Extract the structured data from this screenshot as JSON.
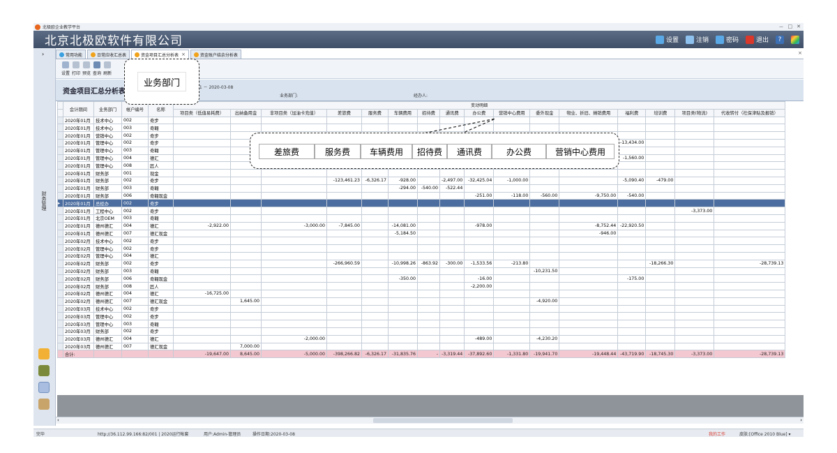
{
  "window": {
    "title": "北极欧企业教学平台",
    "controls": [
      "－",
      "□",
      "✕"
    ]
  },
  "header": {
    "company": "北京北极欧软件有限公司",
    "buttons": [
      {
        "label": "设置",
        "icon": "settings-icon",
        "color": "#5aa9e6"
      },
      {
        "label": "注销",
        "icon": "logout-icon",
        "color": "#8fc1ef"
      },
      {
        "label": "密码",
        "icon": "password-icon",
        "color": "#5aa9e6"
      },
      {
        "label": "退出",
        "icon": "power-icon",
        "color": "#d9382b"
      },
      {
        "label": "?",
        "icon": "help-icon",
        "color": "#3c6fb4"
      }
    ]
  },
  "sidebar": {
    "label": "财务管理",
    "collapse": "›"
  },
  "tabs": [
    {
      "label": "常用功能",
      "active": false
    },
    {
      "label": "日常应收汇总表",
      "active": false
    },
    {
      "label": "资金项目汇总分析表",
      "active": true
    },
    {
      "label": "资金账户结余分析表",
      "active": false
    }
  ],
  "toolbar": [
    "设置",
    "打印",
    "预览",
    "查询",
    "刷新"
  ],
  "report": {
    "title": "资金项目汇总分析表",
    "period": "01 － 2020-03-08",
    "dept_label": "业务部门:",
    "agent_label": "经办人:"
  },
  "grid": {
    "group_header": "变动明细",
    "columns": [
      "会计期间",
      "业务部门",
      "帐户编号",
      "名称",
      "项目类（低值易耗费）",
      "出纳备用金",
      "非项目类（加油卡充值）",
      "差旅费",
      "服务费",
      "车辆费用",
      "招待费",
      "通讯费",
      "办公费",
      "营销中心费用",
      "委外现金",
      "物业、折旧、摊销费用",
      "福利费",
      "培训费",
      "项目类(物流)",
      "代收转付（社保津贴及报销）"
    ],
    "rows": [
      {
        "c": [
          "2020年01月",
          "技术中心",
          "002",
          "奇步",
          "",
          "",
          "",
          "",
          "",
          "",
          "",
          "",
          "",
          "",
          "",
          "",
          "",
          "",
          "",
          ""
        ]
      },
      {
        "c": [
          "2020年01月",
          "技术中心",
          "003",
          "奇翱",
          "",
          "",
          "",
          "",
          "",
          "",
          "",
          "",
          "",
          "",
          "",
          "",
          "",
          "",
          "",
          ""
        ]
      },
      {
        "c": [
          "2020年01月",
          "营销中心",
          "002",
          "奇步",
          "",
          "",
          "",
          "",
          "",
          "",
          "",
          "",
          "",
          "",
          "",
          "",
          "",
          "",
          "",
          ""
        ]
      },
      {
        "c": [
          "2020年01月",
          "管理中心",
          "002",
          "奇步",
          "",
          "",
          "",
          "",
          "",
          "",
          "",
          "",
          "",
          "",
          "",
          "",
          "-13,434.00",
          "",
          "",
          ""
        ]
      },
      {
        "c": [
          "2020年01月",
          "管理中心",
          "003",
          "奇翱",
          "",
          "",
          "",
          "",
          "",
          "",
          "",
          "",
          "",
          "",
          "",
          "",
          "",
          "",
          "",
          ""
        ]
      },
      {
        "c": [
          "2020年01月",
          "管理中心",
          "004",
          "德汇",
          "",
          "",
          "",
          "",
          "",
          "",
          "",
          "",
          "",
          "",
          "",
          "",
          "-1,560.00",
          "",
          "",
          ""
        ]
      },
      {
        "c": [
          "2020年01月",
          "管理中心",
          "008",
          "匠人",
          "",
          "",
          "",
          "",
          "",
          "",
          "",
          "",
          "",
          "",
          "",
          "",
          "",
          "",
          "",
          ""
        ]
      },
      {
        "c": [
          "2020年01月",
          "财务部",
          "001",
          "现金",
          "",
          "",
          "",
          "",
          "",
          "",
          "",
          "",
          "",
          "",
          "",
          "",
          "",
          "",
          "",
          ""
        ]
      },
      {
        "c": [
          "2020年01月",
          "财务部",
          "002",
          "奇步",
          "",
          "",
          "",
          "-123,461.23",
          "-6,326.17",
          "-928.00",
          "",
          "-2,497.00",
          "-32,425.04",
          "-1,000.00",
          "",
          "",
          "-5,090.40",
          "-479.00",
          "",
          ""
        ]
      },
      {
        "c": [
          "2020年01月",
          "财务部",
          "003",
          "奇翱",
          "",
          "",
          "",
          "",
          "",
          "-294.00",
          "-540.00",
          "-522.44",
          "",
          "",
          "",
          "",
          "",
          "",
          "",
          ""
        ]
      },
      {
        "c": [
          "2020年01月",
          "财务部",
          "006",
          "奇翱现金",
          "",
          "",
          "",
          "",
          "",
          "",
          "",
          "",
          "-251.00",
          "-118.00",
          "-560.00",
          "-9,750.00",
          "-540.00",
          "",
          "",
          ""
        ]
      },
      {
        "c": [
          "2020年01月",
          "总经办",
          "002",
          "奇步",
          "",
          "",
          "",
          "",
          "",
          "",
          "",
          "",
          "",
          "",
          "",
          "",
          "",
          "",
          "",
          ""
        ],
        "selected": true
      },
      {
        "c": [
          "2020年01月",
          "工程中心",
          "002",
          "奇步",
          "",
          "",
          "",
          "",
          "",
          "",
          "",
          "",
          "",
          "",
          "",
          "",
          "",
          "",
          "-3,373.00",
          ""
        ]
      },
      {
        "c": [
          "2020年01月",
          "北京OEM",
          "003",
          "奇翱",
          "",
          "",
          "",
          "",
          "",
          "",
          "",
          "",
          "",
          "",
          "",
          "",
          "",
          "",
          "",
          ""
        ]
      },
      {
        "c": [
          "2020年01月",
          "德州德汇",
          "004",
          "德汇",
          "-2,922.00",
          "",
          "-3,000.00",
          "-7,845.00",
          "",
          "-14,081.00",
          "",
          "",
          "-978.00",
          "",
          "",
          "-8,752.44",
          "-22,920.50",
          "",
          "",
          ""
        ]
      },
      {
        "c": [
          "2020年01月",
          "德州德汇",
          "007",
          "德汇现金",
          "",
          "",
          "",
          "",
          "",
          "-5,184.50",
          "",
          "",
          "",
          "",
          "",
          "-946.00",
          "",
          "",
          "",
          ""
        ]
      },
      {
        "c": [
          "2020年02月",
          "技术中心",
          "002",
          "奇步",
          "",
          "",
          "",
          "",
          "",
          "",
          "",
          "",
          "",
          "",
          "",
          "",
          "",
          "",
          "",
          ""
        ]
      },
      {
        "c": [
          "2020年02月",
          "管理中心",
          "002",
          "奇步",
          "",
          "",
          "",
          "",
          "",
          "",
          "",
          "",
          "",
          "",
          "",
          "",
          "",
          "",
          "",
          ""
        ]
      },
      {
        "c": [
          "2020年02月",
          "管理中心",
          "004",
          "德汇",
          "",
          "",
          "",
          "",
          "",
          "",
          "",
          "",
          "",
          "",
          "",
          "",
          "",
          "",
          "",
          ""
        ]
      },
      {
        "c": [
          "2020年02月",
          "财务部",
          "002",
          "奇步",
          "",
          "",
          "",
          "-266,960.59",
          "",
          "-10,998.26",
          "-863.92",
          "-300.00",
          "-1,533.56",
          "-213.80",
          "",
          "",
          "",
          "-18,266.30",
          "",
          "-28,739.13"
        ]
      },
      {
        "c": [
          "2020年02月",
          "财务部",
          "003",
          "奇翱",
          "",
          "",
          "",
          "",
          "",
          "",
          "",
          "",
          "",
          "",
          "-10,231.50",
          "",
          "",
          "",
          "",
          ""
        ]
      },
      {
        "c": [
          "2020年02月",
          "财务部",
          "006",
          "奇翱现金",
          "",
          "",
          "",
          "",
          "",
          "-350.00",
          "",
          "",
          "-16.00",
          "",
          "",
          "",
          "-175.00",
          "",
          "",
          ""
        ]
      },
      {
        "c": [
          "2020年02月",
          "财务部",
          "008",
          "匠人",
          "",
          "",
          "",
          "",
          "",
          "",
          "",
          "",
          "-2,200.00",
          "",
          "",
          "",
          "",
          "",
          "",
          ""
        ]
      },
      {
        "c": [
          "2020年02月",
          "德州德汇",
          "004",
          "德汇",
          "-16,725.00",
          "",
          "",
          "",
          "",
          "",
          "",
          "",
          "",
          "",
          "",
          "",
          "",
          "",
          "",
          ""
        ]
      },
      {
        "c": [
          "2020年02月",
          "德州德汇",
          "007",
          "德汇现金",
          "",
          "1,645.00",
          "",
          "",
          "",
          "",
          "",
          "",
          "",
          "",
          "-4,920.00",
          "",
          "",
          "",
          "",
          ""
        ]
      },
      {
        "c": [
          "2020年03月",
          "技术中心",
          "002",
          "奇步",
          "",
          "",
          "",
          "",
          "",
          "",
          "",
          "",
          "",
          "",
          "",
          "",
          "",
          "",
          "",
          ""
        ]
      },
      {
        "c": [
          "2020年03月",
          "管理中心",
          "002",
          "奇步",
          "",
          "",
          "",
          "",
          "",
          "",
          "",
          "",
          "",
          "",
          "",
          "",
          "",
          "",
          "",
          ""
        ]
      },
      {
        "c": [
          "2020年03月",
          "管理中心",
          "003",
          "奇翱",
          "",
          "",
          "",
          "",
          "",
          "",
          "",
          "",
          "",
          "",
          "",
          "",
          "",
          "",
          "",
          ""
        ]
      },
      {
        "c": [
          "2020年03月",
          "财务部",
          "002",
          "奇步",
          "",
          "",
          "",
          "",
          "",
          "",
          "",
          "",
          "",
          "",
          "",
          "",
          "",
          "",
          "",
          ""
        ]
      },
      {
        "c": [
          "2020年03月",
          "德州德汇",
          "004",
          "德汇",
          "",
          "",
          "-2,000.00",
          "",
          "",
          "",
          "",
          "",
          "-489.00",
          "",
          "-4,230.20",
          "",
          "",
          "",
          "",
          ""
        ]
      },
      {
        "c": [
          "2020年03月",
          "德州德汇",
          "007",
          "德汇现金",
          "",
          "7,000.00",
          "",
          "",
          "",
          "",
          "",
          "",
          "",
          "",
          "",
          "",
          "",
          "",
          "",
          ""
        ]
      }
    ],
    "total": [
      "合计:",
      "",
      "",
      "",
      "-19,647.00",
      "8,645.00",
      "-5,000.00",
      "-398,266.82",
      "-6,326.17",
      "-31,835.76",
      "-",
      "-3,319.44",
      "-37,892.60",
      "-1,331.80",
      "-19,941.70",
      "-19,448.44",
      "-43,719.90",
      "-18,745.30",
      "-3,373.00",
      "-28,739.13"
    ]
  },
  "status": {
    "ready": "完毕",
    "url": "http://36.112.99.166:82/001 | 2020运行帐套",
    "user": "用户:Admin-管理员",
    "date": "操作日期:2020-03-08",
    "mywork": "我的工作",
    "skin": "皮肤:[Office 2010 Blue] ▾"
  },
  "callouts": {
    "dept": "业务部门",
    "expenses": [
      "差旅费",
      "服务费",
      "车辆费用",
      "招待费",
      "通讯费",
      "办公费",
      "营销中心费用"
    ]
  },
  "colors": {
    "header": "#4a5b75",
    "selected_row": "#4b6d9f",
    "total_row": "#f4c8d0"
  }
}
